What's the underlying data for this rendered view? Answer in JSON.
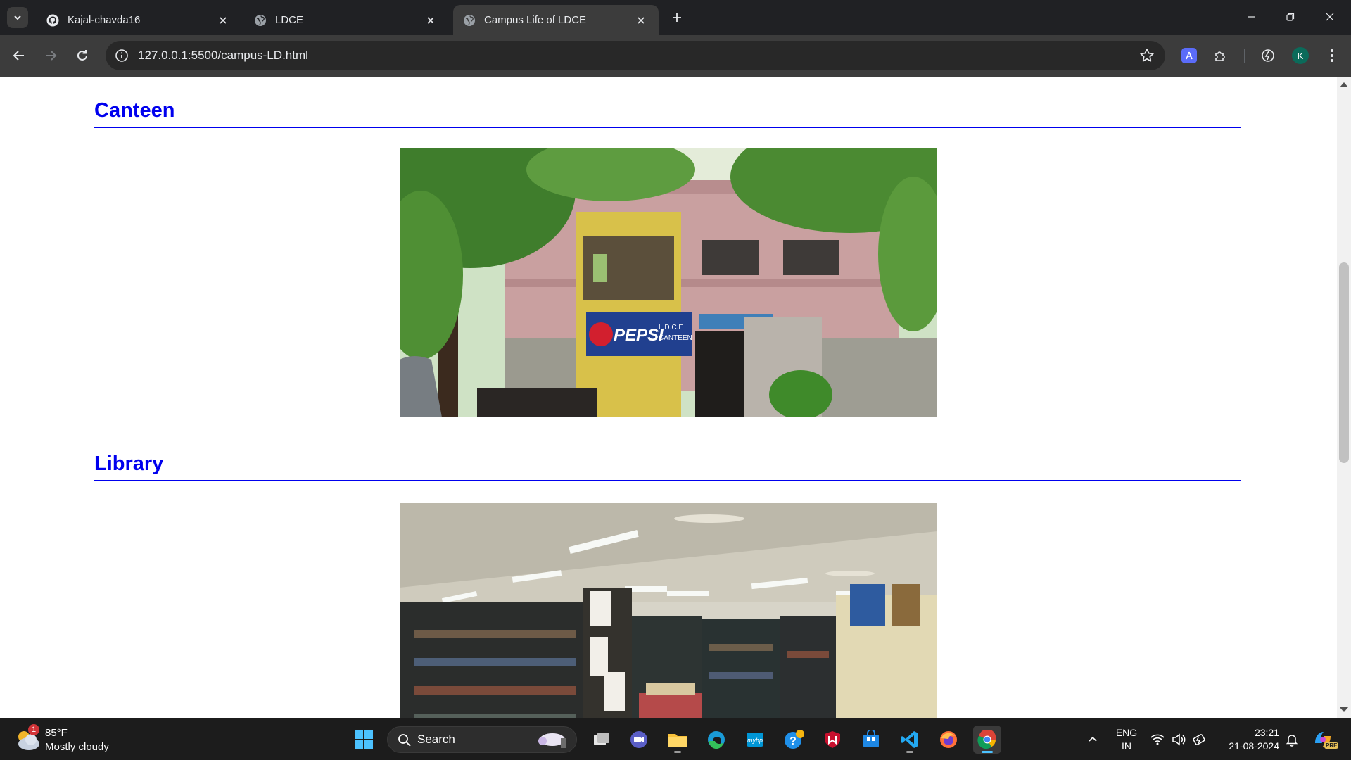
{
  "browser": {
    "tabs": [
      {
        "title": "Kajal-chavda16",
        "favicon": "github-icon",
        "active": false
      },
      {
        "title": "LDCE",
        "favicon": "globe-icon",
        "active": false
      },
      {
        "title": "Campus Life of LDCE",
        "favicon": "globe-icon",
        "active": true
      }
    ],
    "url": "127.0.0.1:5500/campus-LD.html",
    "profile_initial": "K"
  },
  "page": {
    "sections": [
      {
        "heading": "Canteen",
        "image": "canteen-photo",
        "sign_brand": "PEPSI",
        "sign_text_1": "L.D.C.E",
        "sign_text_2": "CANTEEN"
      },
      {
        "heading": "Library",
        "image": "library-photo"
      }
    ],
    "heading_color": "#0000ee"
  },
  "taskbar": {
    "weather": {
      "temp": "85°F",
      "condition": "Mostly cloudy",
      "badge": "1"
    },
    "search_label": "Search",
    "language_top": "ENG",
    "language_bottom": "IN",
    "time": "23:21",
    "date": "21-08-2024",
    "copilot_badge": "PRE"
  }
}
